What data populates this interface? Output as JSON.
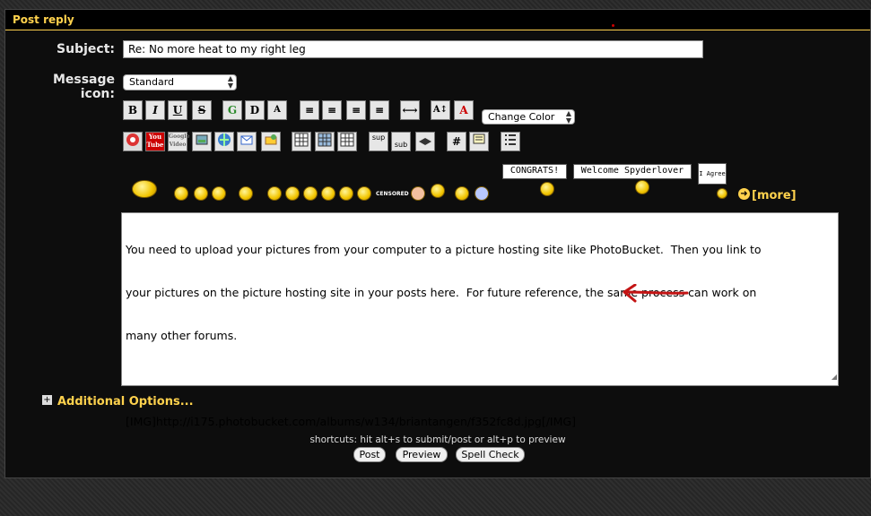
{
  "header": {
    "title": "Post reply"
  },
  "form": {
    "subject_label": "Subject:",
    "subject_value": "Re: No more heat to my right leg",
    "icon_label": "Message icon:",
    "icon_value": "Standard",
    "change_color": "Change Color"
  },
  "toolbar": {
    "row1": [
      "B",
      "I",
      "U",
      "S",
      "G",
      "D",
      "A",
      "≡",
      "≡",
      "≡",
      "≡",
      "⟷",
      "A↕",
      "A"
    ],
    "row2": [
      "sup",
      "sub",
      "#"
    ]
  },
  "smilies": {
    "signs": [
      "CONGRATS!",
      "Welcome Spyderlover",
      "I Agree"
    ],
    "censored": "CENSORED",
    "more": "[more]"
  },
  "message": {
    "lines": [
      "You need to upload your pictures from your computer to a picture hosting site like PhotoBucket.  Then you link to",
      "your pictures on the picture hosting site in your posts here.  For future reference, the same process can work on",
      "many other forums.",
      "",
      "[IMG]http://i175.photobucket.com/albums/w134/briantangen/f352fc8d.jpg[/IMG]"
    ]
  },
  "additional": {
    "label": "Additional Options..."
  },
  "footer": {
    "shortcuts": "shortcuts: hit alt+s to submit/post or alt+p to preview",
    "post": "Post",
    "preview": "Preview",
    "spell": "Spell Check"
  }
}
